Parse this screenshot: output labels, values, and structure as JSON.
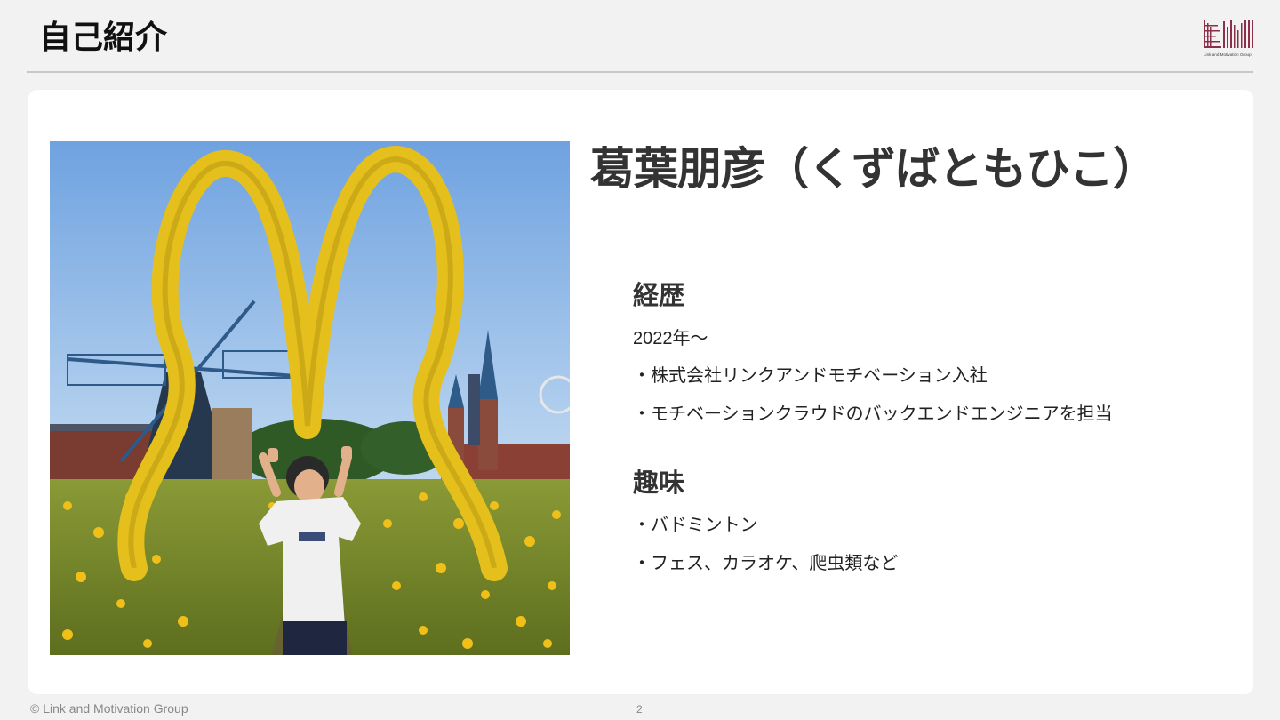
{
  "slide": {
    "title": "自己紹介",
    "logo_text": "Link and Motivation Group"
  },
  "profile": {
    "name": "葛葉朋彦（くずばともひこ）",
    "career": {
      "heading": "経歴",
      "lines": [
        "2022年〜",
        "・株式会社リンクアンドモチベーション入社",
        "・モチベーションクラウドのバックエンドエンジニアを担当"
      ]
    },
    "hobby": {
      "heading": "趣味",
      "lines": [
        "・バドミントン",
        "・フェス、カラオケ、爬虫類など"
      ]
    }
  },
  "footer": {
    "copyright": "© Link and Motivation Group",
    "page_number": "2"
  },
  "colors": {
    "background": "#f2f2f2",
    "card": "#ffffff",
    "logo_accent": "#8b2f4a",
    "arch_yellow": "#e8c21c"
  },
  "icons": {
    "logo": "lm-logo-icon"
  }
}
